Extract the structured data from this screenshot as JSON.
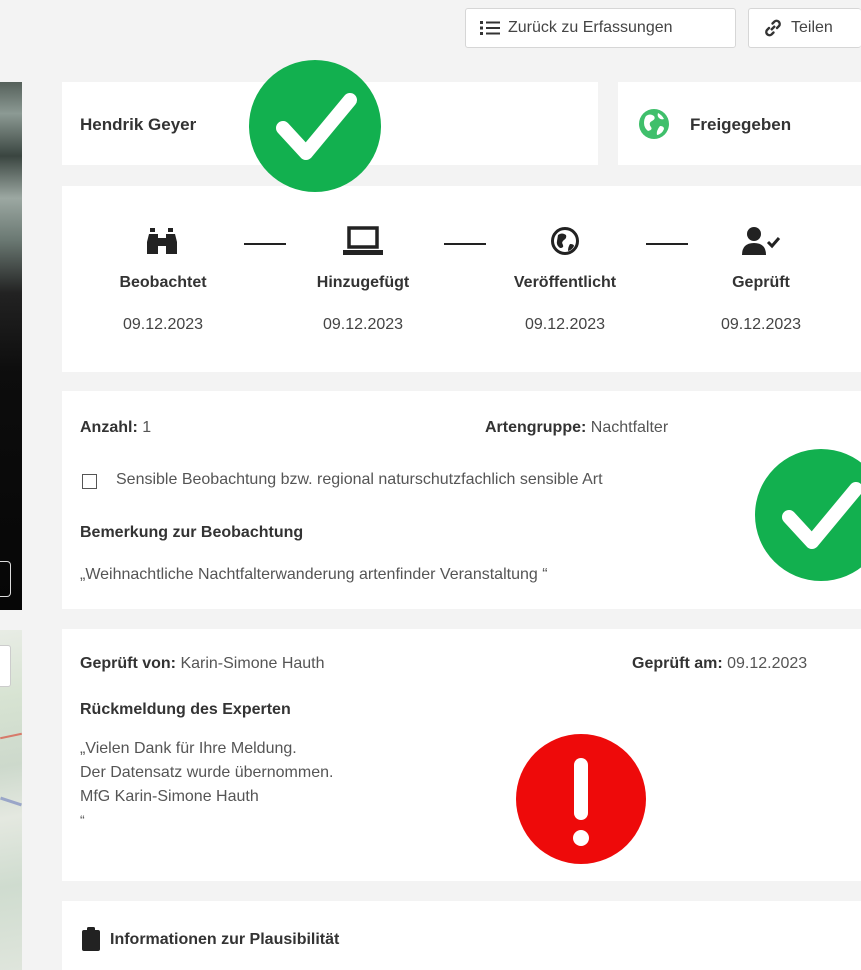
{
  "toolbar": {
    "back_label": "Zurück zu Erfassungen",
    "share_label": "Teilen"
  },
  "observer": {
    "name": "Hendrik Geyer"
  },
  "status": {
    "label": "Freigegeben"
  },
  "timeline": [
    {
      "label": "Beobachtet",
      "date": "09.12.2023",
      "icon": "binoculars-icon"
    },
    {
      "label": "Hinzugefügt",
      "date": "09.12.2023",
      "icon": "laptop-icon"
    },
    {
      "label": "Veröffentlicht",
      "date": "09.12.2023",
      "icon": "globe-icon"
    },
    {
      "label": "Geprüft",
      "date": "09.12.2023",
      "icon": "user-check-icon"
    }
  ],
  "details": {
    "count_label": "Anzahl:",
    "count_value": "1",
    "group_label": "Artengruppe:",
    "group_value": "Nachtfalter",
    "sensitive_label": "Sensible Beobachtung bzw. regional naturschutzfachlich sensible Art",
    "sensitive_checked": false,
    "remark_title": "Bemerkung zur Beobachtung",
    "remark_text": "„Weihnachtliche Nachtfalterwanderung artenfinder Veranstaltung “"
  },
  "review": {
    "checked_by_label": "Geprüft von:",
    "checked_by_value": "Karin-Simone Hauth",
    "checked_on_label": "Geprüft am:",
    "checked_on_value": "09.12.2023",
    "feedback_title": "Rückmeldung des Experten",
    "feedback_lines": [
      "„Vielen Dank für Ihre Meldung.",
      "Der Datensatz wurde übernommen.",
      "MfG Karin-Simone Hauth",
      "“"
    ]
  },
  "plausibility": {
    "title": "Informationen zur Plausibilität"
  },
  "colors": {
    "green_badge": "#12b04f",
    "red_badge": "#ee0a0a",
    "globe_green": "#3fbf6b"
  }
}
